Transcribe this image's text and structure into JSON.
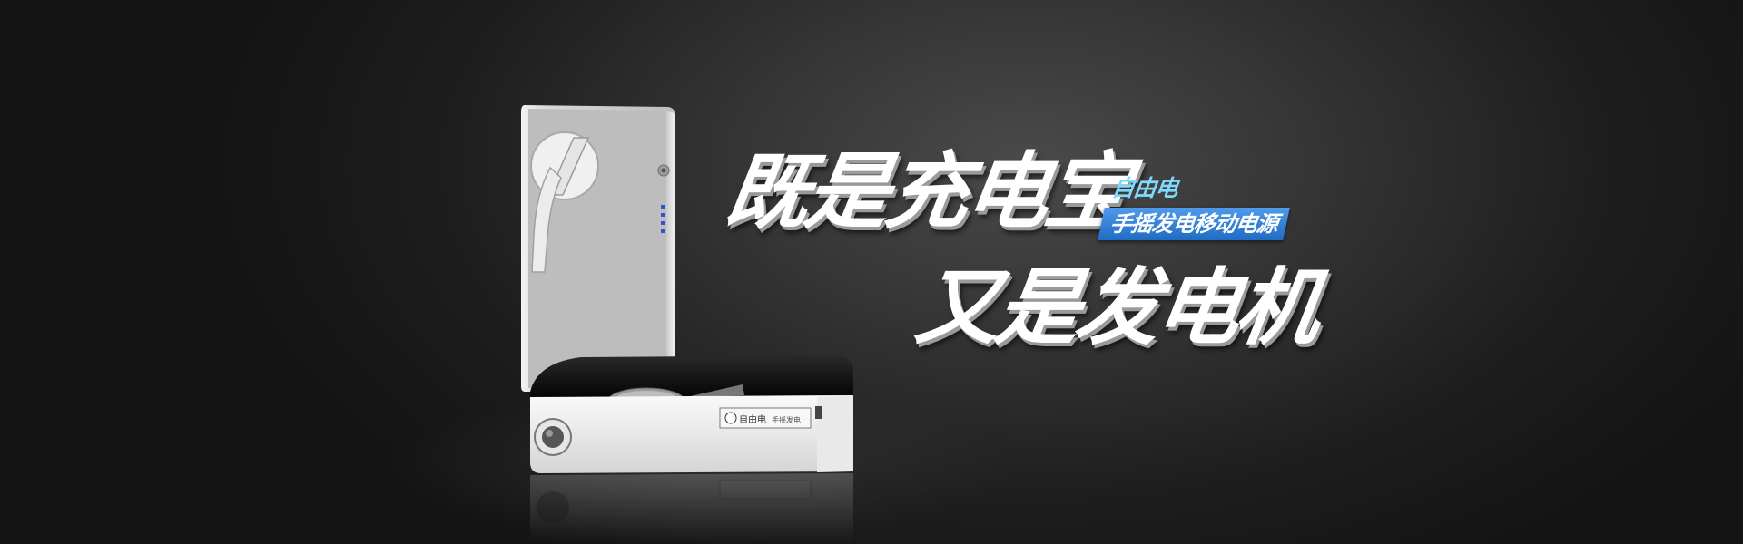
{
  "banner": {
    "headline_line1": "既是充电宝",
    "headline_line2": "又是发电机",
    "tagline_small": "自由电",
    "tagline_box": "手摇发电移动电源"
  },
  "product": {
    "brand_label": "自由电",
    "model_label": "手摇发电"
  },
  "colors": {
    "tagline_text": "#7fd9ff",
    "tagline_box_bg": "#2f7fd6",
    "headline": "#ffffff",
    "led": "#2f4fd8"
  },
  "icons": [
    "crank-handle-icon",
    "power-button-icon",
    "battery-led-indicator-icon",
    "flashlight-lens-icon",
    "usb-port-icon"
  ]
}
